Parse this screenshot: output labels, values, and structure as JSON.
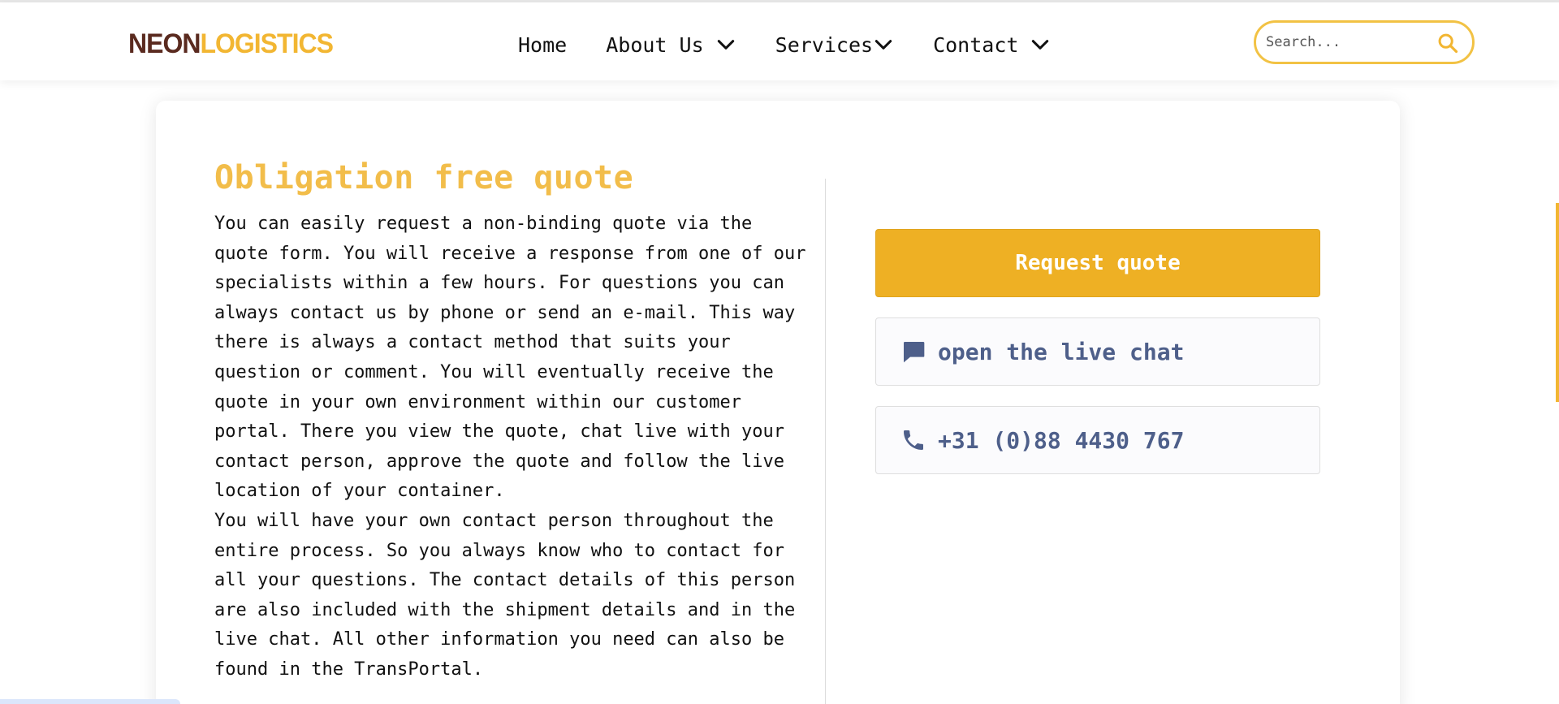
{
  "header": {
    "logo": {
      "part1": "NEON",
      "part2": "LOGISTICS"
    },
    "nav": [
      {
        "label": "Home",
        "has_dropdown": false
      },
      {
        "label": "About Us",
        "has_dropdown": true
      },
      {
        "label": "Services",
        "has_dropdown": true
      },
      {
        "label": "Contact",
        "has_dropdown": true
      }
    ],
    "search": {
      "placeholder": "Search...",
      "icon": "search-icon"
    }
  },
  "main": {
    "title": "Obligation free quote",
    "paragraphs": [
      "You can easily request a non-binding quote via the quote form. You will receive a response from one of our specialists within a few hours. For questions you can always contact us by phone or send an e-mail. This way there is always a contact method that suits your question or comment. You will eventually receive the quote in your own environment within our customer portal. There you view the quote, chat live with your contact person, approve the quote and follow the live location of your container.",
      "You will have your own contact person throughout the entire process. So you always know who to contact for all your questions. The contact details of this person are also included with the shipment details and in the live chat. All other information you need can also be found in the TransPortal."
    ]
  },
  "sidebar_actions": {
    "request_quote": "Request quote",
    "live_chat": {
      "label": "open the live chat",
      "icon": "chat-icon"
    },
    "phone": {
      "label": "+31 (0)88 4430 767",
      "icon": "phone-icon"
    }
  },
  "colors": {
    "accent": "#eeb024",
    "heading": "#f2bd4a",
    "logo_dark": "#5a2a1f",
    "secondary_text": "#4e5f8a"
  }
}
